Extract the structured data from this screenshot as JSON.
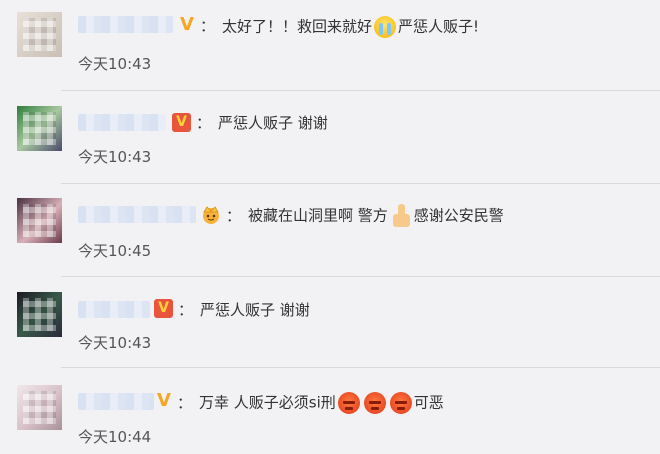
{
  "comments": [
    {
      "name_tail": "",
      "badge": "V",
      "colon": "：",
      "text_parts": [
        "太好了！！救回来就好",
        "严惩人贩子!"
      ],
      "emoji": "crying-face-icon",
      "time": "今天10:43"
    },
    {
      "name_tail": "",
      "badge": "V",
      "colon": "：",
      "text": "严惩人贩子 谢谢",
      "time": "今天10:43"
    },
    {
      "name_tail": "",
      "badge": "crown",
      "colon": "：",
      "text_parts": [
        "被藏在山洞里啊 警方",
        "感谢公安民警"
      ],
      "emoji": "thumbs-up-icon",
      "time": "今天10:45"
    },
    {
      "name_tail": "",
      "badge": "V",
      "colon": "：",
      "text": "严惩人贩子 谢谢",
      "time": "今天10:43"
    },
    {
      "name_tail": "",
      "badge": "V",
      "colon": "：",
      "text_parts": [
        "万幸 人贩子必须si刑",
        "可恶"
      ],
      "emoji": "angry-face-icon",
      "time": "今天10:44"
    }
  ],
  "colors": {
    "background": "#f2f2f5",
    "badge_gold": "#f5a623",
    "badge_red": "#e8543c",
    "name_blue": "#5a7ec8"
  }
}
